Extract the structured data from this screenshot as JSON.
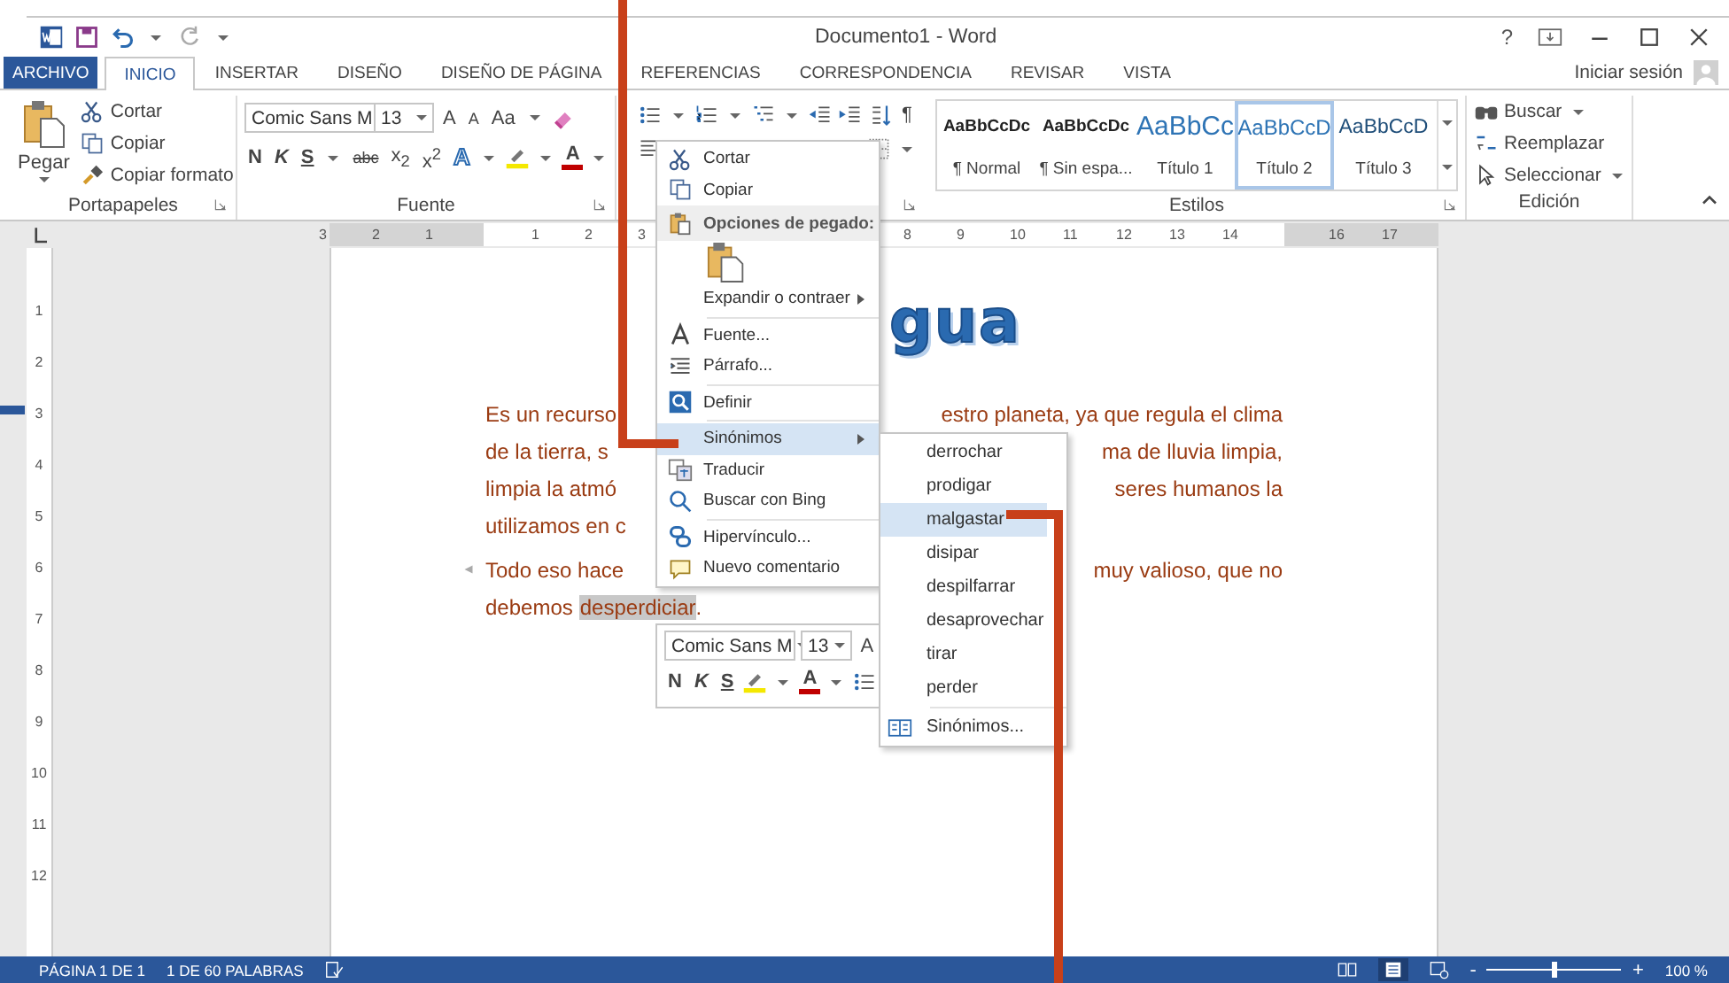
{
  "title_bar": {
    "title": "Documento1 - Word",
    "help": "?"
  },
  "tabs": [
    {
      "label": "ARCHIVO",
      "selected": false,
      "kind": "file"
    },
    {
      "label": "INICIO",
      "selected": true,
      "kind": "tab"
    },
    {
      "label": "INSERTAR",
      "selected": false,
      "kind": "tab"
    },
    {
      "label": "DISEÑO",
      "selected": false,
      "kind": "tab"
    },
    {
      "label": "DISEÑO DE PÁGINA",
      "selected": false,
      "kind": "tab"
    },
    {
      "label": "REFERENCIAS",
      "selected": false,
      "kind": "tab"
    },
    {
      "label": "CORRESPONDENCIA",
      "selected": false,
      "kind": "tab"
    },
    {
      "label": "REVISAR",
      "selected": false,
      "kind": "tab"
    },
    {
      "label": "VISTA",
      "selected": false,
      "kind": "tab"
    }
  ],
  "account": {
    "label": "Iniciar sesión"
  },
  "ribbon": {
    "clipboard": {
      "paste": "Pegar",
      "items": [
        "Cortar",
        "Copiar",
        "Copiar formato"
      ],
      "label": "Portapapeles"
    },
    "font": {
      "name": "Comic Sans M",
      "size": "13",
      "grow": "A",
      "shrink": "A",
      "case": "Aa",
      "bold": "N",
      "italic": "K",
      "underline": "S",
      "strike": "abc",
      "subscript": "x$_{2}$",
      "superscript": "x$^{2}$",
      "effects": "A",
      "font_color": "A",
      "label": "Fuente"
    },
    "paragraph": {
      "marks": "¶"
    },
    "styles": {
      "label": "Estilos",
      "items": [
        {
          "preview": "AaBbCcDc",
          "name": "¶ Normal",
          "kind": "body",
          "selected": false
        },
        {
          "preview": "AaBbCcDc",
          "name": "¶ Sin espa...",
          "kind": "body",
          "selected": false
        },
        {
          "preview": "AaBbCc",
          "name": "Título 1",
          "kind": "h1",
          "selected": false
        },
        {
          "preview": "AaBbCcD",
          "name": "Título 2",
          "kind": "h2",
          "selected": true
        },
        {
          "preview": "AaBbCcD",
          "name": "Título 3",
          "kind": "h3",
          "selected": false
        }
      ]
    },
    "editing": {
      "items": [
        "Buscar",
        "Reemplazar",
        "Seleccionar"
      ],
      "label": "Edición"
    }
  },
  "ruler": {
    "numbers": [
      "3",
      "2",
      "1",
      "1",
      "2",
      "3",
      "8",
      "9",
      "10",
      "11",
      "12",
      "13",
      "14",
      "16",
      "17"
    ],
    "vertical": [
      "1",
      "2",
      "3",
      "4",
      "5",
      "6",
      "7",
      "8",
      "9",
      "10",
      "11",
      "12"
    ]
  },
  "document": {
    "heading": "gua",
    "lines": [
      {
        "left": "Es un recurso",
        "right": "estro planeta, ya que regula el clima",
        "paragraph_start": false
      },
      {
        "left": "de la tierra, s",
        "right": "ma de lluvia limpia,",
        "paragraph_start": false
      },
      {
        "left": "limpia la atmó",
        "right": "seres humanos la",
        "paragraph_start": false
      },
      {
        "left": "utilizamos en c",
        "paragraph_start": false
      },
      {
        "left": "Todo eso hace",
        "right": "muy valioso, que no",
        "paragraph_start": true
      },
      {
        "left": "debemos",
        "selection": "desperdiciar",
        "after": ".",
        "paragraph_start": false
      }
    ]
  },
  "context_menu": {
    "items": [
      {
        "kind": "item",
        "label": "Cortar"
      },
      {
        "kind": "item",
        "label": "Copiar"
      },
      {
        "kind": "header",
        "label": "Opciones de pegado:"
      },
      {
        "kind": "paste"
      },
      {
        "kind": "submenu",
        "label": "Expandir o contraer",
        "selected": false
      },
      {
        "kind": "separator"
      },
      {
        "kind": "item",
        "label": "Fuente..."
      },
      {
        "kind": "item",
        "label": "Párrafo..."
      },
      {
        "kind": "separator"
      },
      {
        "kind": "item",
        "label": "Definir"
      },
      {
        "kind": "separator"
      },
      {
        "kind": "submenu",
        "label": "Sinónimos",
        "selected": true
      },
      {
        "kind": "item",
        "label": "Traducir"
      },
      {
        "kind": "item",
        "label": "Buscar con Bing"
      },
      {
        "kind": "separator"
      },
      {
        "kind": "item",
        "label": "Hipervínculo..."
      },
      {
        "kind": "item",
        "label": "Nuevo comentario"
      }
    ]
  },
  "synonyms_menu": {
    "items": [
      {
        "label": "derrochar",
        "selected": false
      },
      {
        "label": "prodigar",
        "selected": false
      },
      {
        "label": "malgastar",
        "selected": true
      },
      {
        "label": "disipar",
        "selected": false
      },
      {
        "label": "despilfarrar",
        "selected": false
      },
      {
        "label": "desaprovechar",
        "selected": false
      },
      {
        "label": "tirar",
        "selected": false
      },
      {
        "label": "perder",
        "selected": false
      }
    ],
    "footer": "Sinónimos..."
  },
  "mini_toolbar": {
    "font": "Comic Sans M",
    "size": "13",
    "grow": "A",
    "bold": "N",
    "italic": "K",
    "underline": "S",
    "font_color": "A"
  },
  "status_bar": {
    "page": "PÁGINA 1 DE 1",
    "words": "1 DE 60 PALABRAS",
    "zoom_out": "-",
    "zoom_in": "+",
    "zoom_slider": {
      "level": 0.5
    },
    "zoom": "100 %"
  }
}
